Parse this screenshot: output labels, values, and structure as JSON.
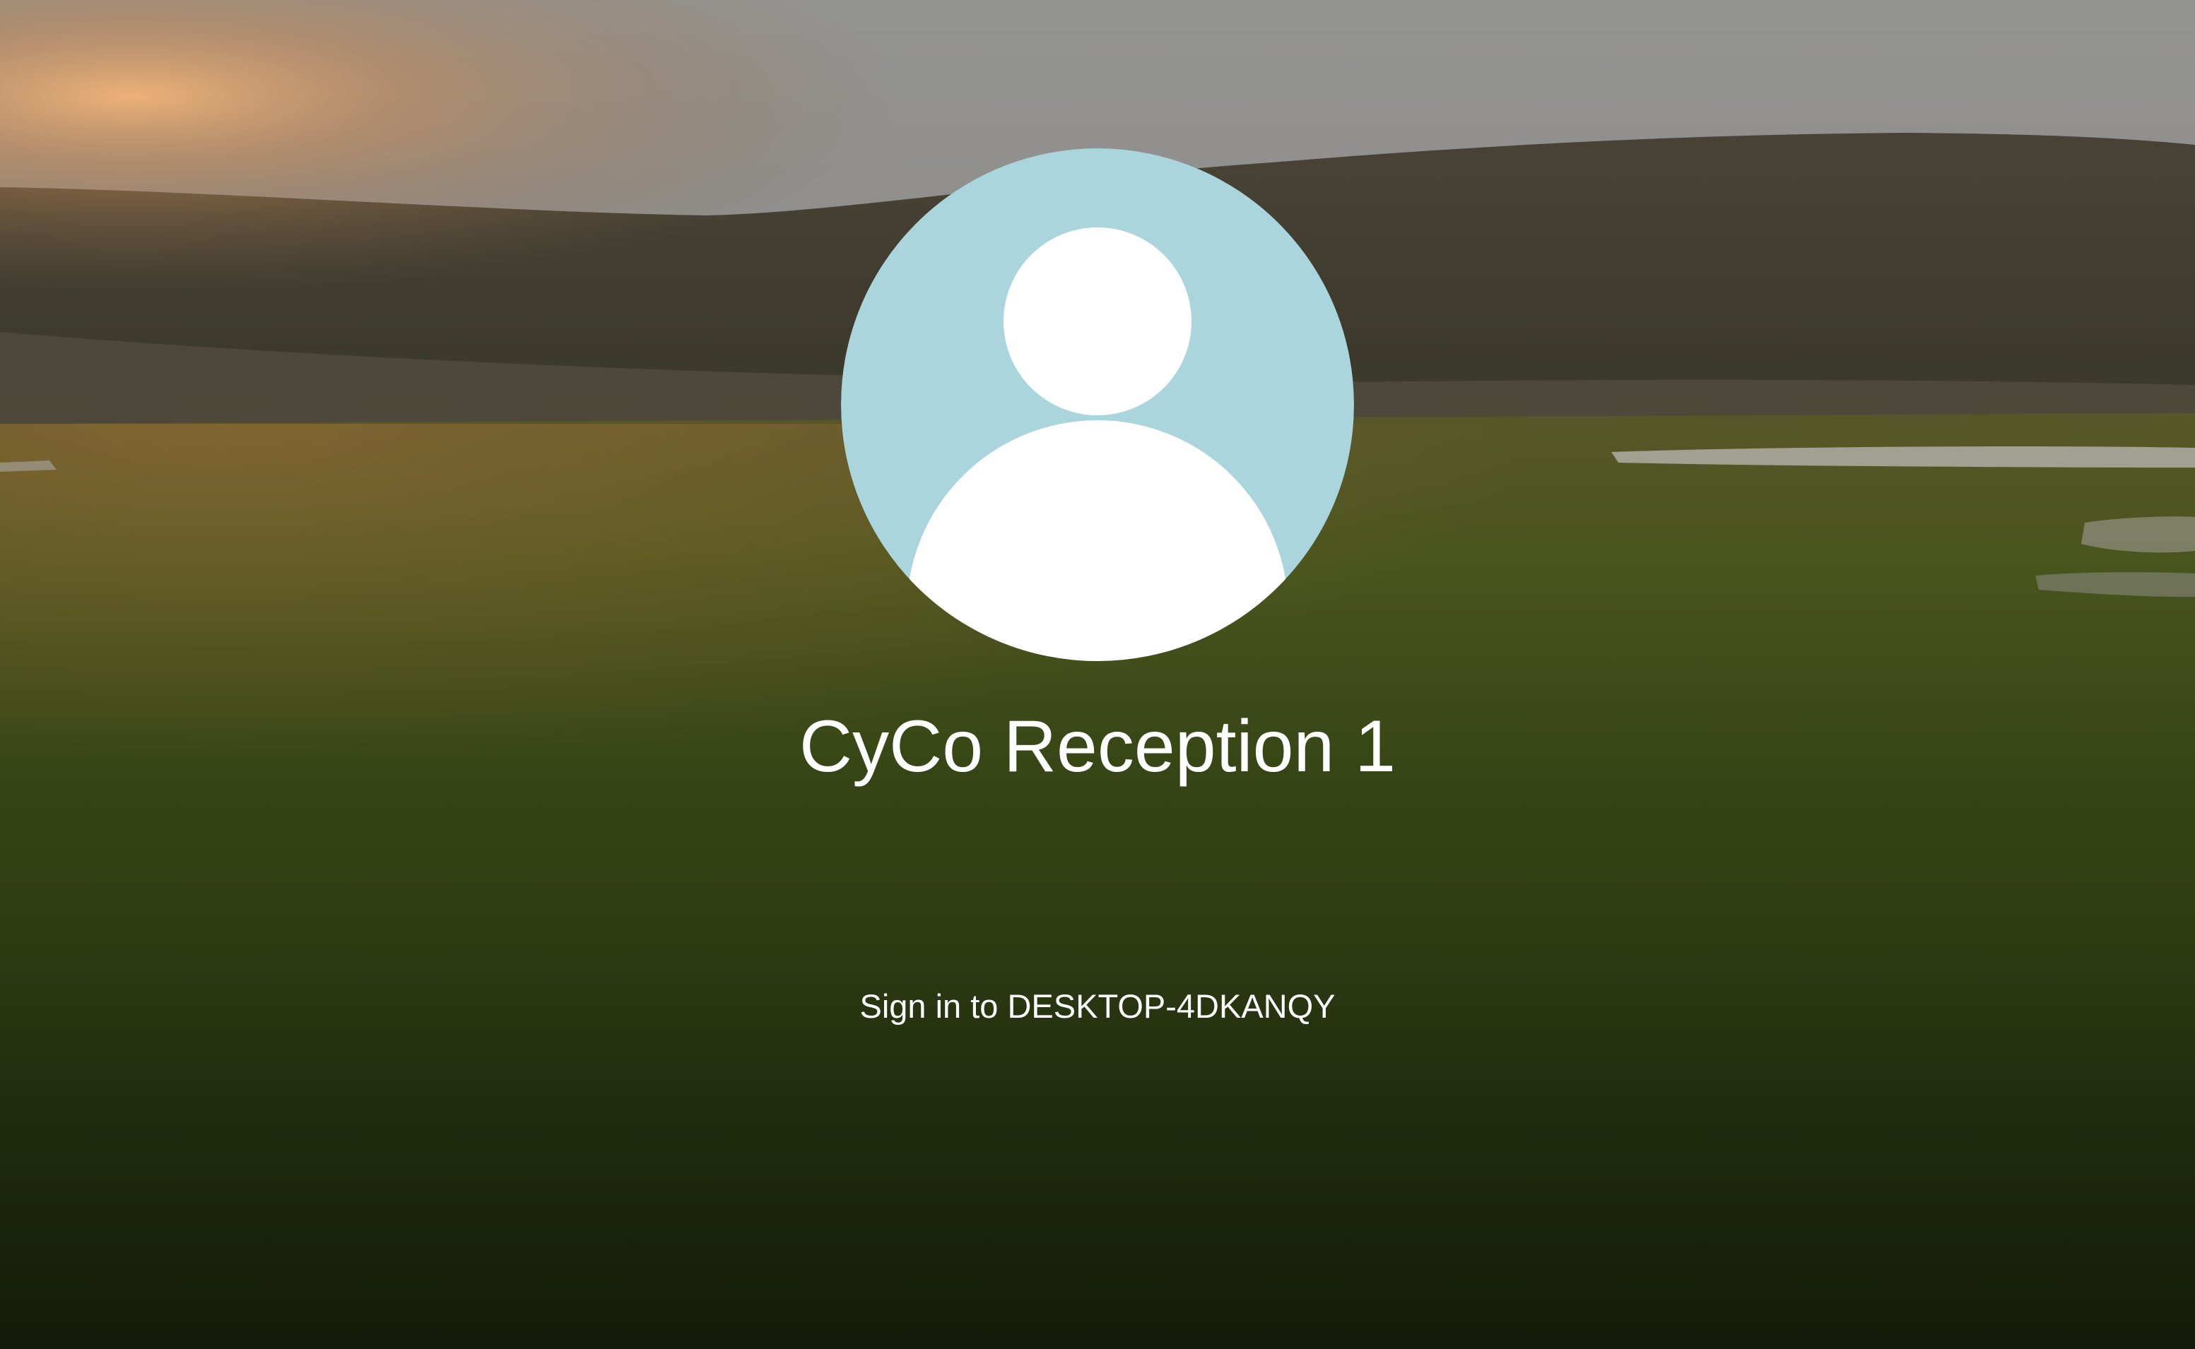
{
  "lock_screen": {
    "wallpaper_icon": "grass-field-at-sunset",
    "user": {
      "avatar_icon": "default-user-icon",
      "avatar_bg_color": "#aad5dc",
      "avatar_fg_color": "#ffffff",
      "name": "CyCo Reception 1"
    },
    "sign_in_label": "Sign in to DESKTOP-4DKANQY"
  }
}
